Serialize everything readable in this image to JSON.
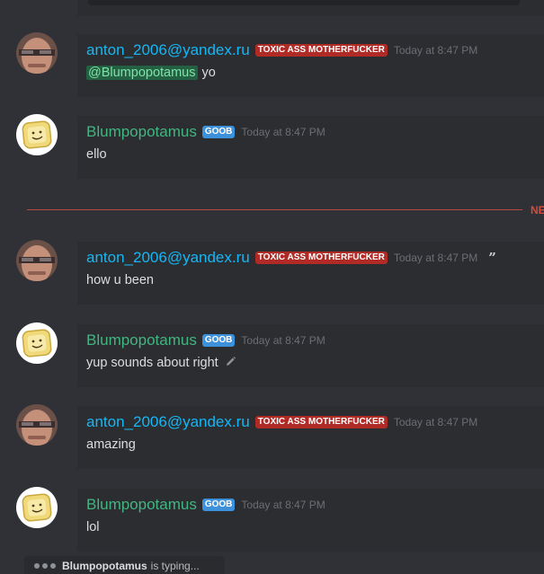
{
  "theme": {
    "background": "#2f3136",
    "bubble": "#2b2d31",
    "username_blue": "#15b7f5",
    "username_green": "#43b581",
    "tag_red": "#b02a26",
    "tag_blue": "#3d91db",
    "new_red": "#d44b3e"
  },
  "users": {
    "anton": {
      "name": "anton_2006@yandex.ru",
      "tag": "TOXIC ASS MOTHERFUCKER",
      "avatar": "face-photo-avatar"
    },
    "blump": {
      "name": "Blumpopotamus",
      "tag": "GOOB",
      "avatar": "toast-avatar"
    }
  },
  "messages": [
    {
      "user": "anton",
      "time": "Today at 8:47 PM",
      "mention": "@Blumpopotamus",
      "text": "yo"
    },
    {
      "user": "blump",
      "time": "Today at 8:47 PM",
      "text": "ello"
    },
    {
      "user": "anton",
      "time": "Today at 8:47 PM",
      "text": "how u been",
      "quote_icon": "”"
    },
    {
      "user": "blump",
      "time": "Today at 8:47 PM",
      "text": "yup sounds about right",
      "edit_icon": "pencil-icon"
    },
    {
      "user": "anton",
      "time": "Today at 8:47 PM",
      "text": "amazing"
    },
    {
      "user": "blump",
      "time": "Today at 8:47 PM",
      "text": "lol"
    }
  ],
  "new_divider": {
    "label": "NE"
  },
  "typing": {
    "name": "Blumpopotamus",
    "suffix": "is typing..."
  }
}
